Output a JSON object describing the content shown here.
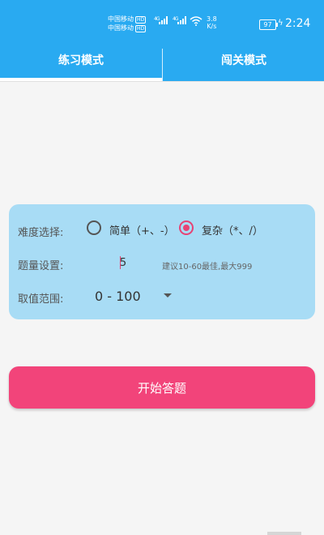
{
  "status_bar": {
    "carrier_1": "中国移动",
    "carrier_2": "中国移动",
    "hd_badge": "HD",
    "network_type": "4G",
    "speed_value": "3.8",
    "speed_unit": "K/s",
    "battery_level": "97",
    "time": "2:24"
  },
  "tabs": [
    {
      "label": "练习模式",
      "selected": true
    },
    {
      "label": "闯关模式",
      "selected": false
    }
  ],
  "settings": {
    "difficulty": {
      "label": "难度选择:",
      "options": [
        {
          "label": "简单（+、-）",
          "selected": false
        },
        {
          "label": "复杂（*、/）",
          "selected": true
        }
      ]
    },
    "question_count": {
      "label": "题量设置:",
      "value": "5",
      "hint": "建议10-60最佳,最大999"
    },
    "value_range": {
      "label": "取值范围:",
      "selected": "0 - 100"
    }
  },
  "start_button": {
    "label": "开始答题"
  },
  "colors": {
    "primary": "#29aaf1",
    "card": "#a8dcf5",
    "accent": "#f2447a",
    "radio_selected": "#e74274"
  },
  "icons": {
    "signal": "signal-bars-icon",
    "wifi": "wifi-icon",
    "battery": "battery-icon",
    "charging": "lightning-bolt-icon",
    "dropdown": "triangle-down-icon"
  }
}
